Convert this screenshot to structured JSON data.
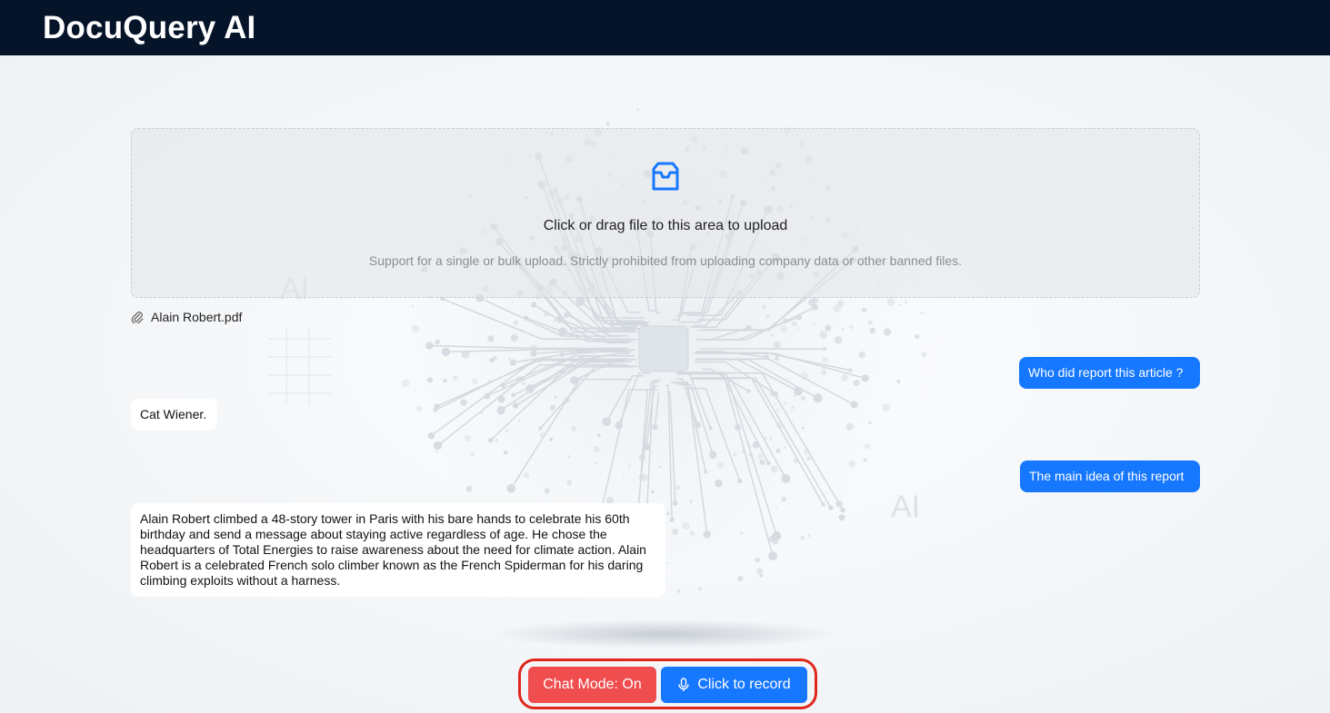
{
  "header": {
    "title": "DocuQuery AI"
  },
  "upload": {
    "title": "Click or drag file to this area to upload",
    "hint": "Support for a single or bulk upload. Strictly prohibited from uploading company data or other banned files.",
    "icon": "inbox-icon"
  },
  "files": [
    {
      "name": "Alain Robert.pdf",
      "icon": "paperclip-icon"
    }
  ],
  "chat": {
    "messages": [
      {
        "role": "user",
        "text": "Who did report this article ?"
      },
      {
        "role": "bot",
        "text": "Cat Wiener."
      },
      {
        "role": "user",
        "text": "The main idea of this report"
      },
      {
        "role": "bot",
        "text": "Alain Robert climbed a 48-story tower in Paris with his bare hands to celebrate his 60th birthday and send a message about staying active regardless of age. He chose the headquarters of Total Energies to raise awareness about the need for climate action. Alain Robert is a celebrated French solo climber known as the French Spiderman for his daring climbing exploits without a harness."
      }
    ]
  },
  "background": {
    "watermark_left": "AI",
    "watermark_right": "AI"
  },
  "controls": {
    "chat_mode_label": "Chat Mode: On",
    "record_label": "Click to record",
    "record_icon": "microphone-icon"
  },
  "colors": {
    "header_bg": "#051428",
    "primary": "#1677ff",
    "danger": "#f04d4f",
    "highlight_ring": "#e0261c"
  }
}
